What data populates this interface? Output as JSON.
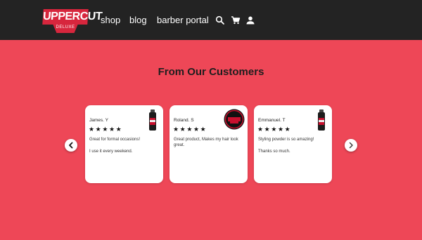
{
  "brand": {
    "name_top": "UPPERCUT",
    "name_bottom": "DELUXE"
  },
  "nav": [
    {
      "label": "shop"
    },
    {
      "label": "blog"
    },
    {
      "label": "barber portal"
    }
  ],
  "header_icons": [
    "search-icon",
    "cart-icon",
    "user-icon"
  ],
  "section": {
    "title": "From Our Customers"
  },
  "carousel": {
    "prev_icon": "chevron-left-icon",
    "next_icon": "chevron-right-icon"
  },
  "reviews": [
    {
      "name": "James. Y",
      "stars": "★★★★★",
      "rating": 5,
      "line1": "Great for formal occasions!",
      "line2": "I use it every weekend.",
      "product_icon": "powder-bottle-icon"
    },
    {
      "name": "Roland. S",
      "stars": "★★★★★",
      "rating": 5,
      "line1": "Great product, Makes my hair look great.",
      "line2": "",
      "product_icon": "pomade-tin-icon"
    },
    {
      "name": "Emmanuel. T",
      "stars": "★★★★★",
      "rating": 5,
      "line1": "Styling powder is so amazing!",
      "line2": "Thanks so much.",
      "product_icon": "powder-bottle-icon"
    }
  ],
  "colors": {
    "header_bg": "#232323",
    "page_bg": "#ee4757",
    "brand_red": "#d7263d",
    "card_bg": "#ffffff"
  }
}
